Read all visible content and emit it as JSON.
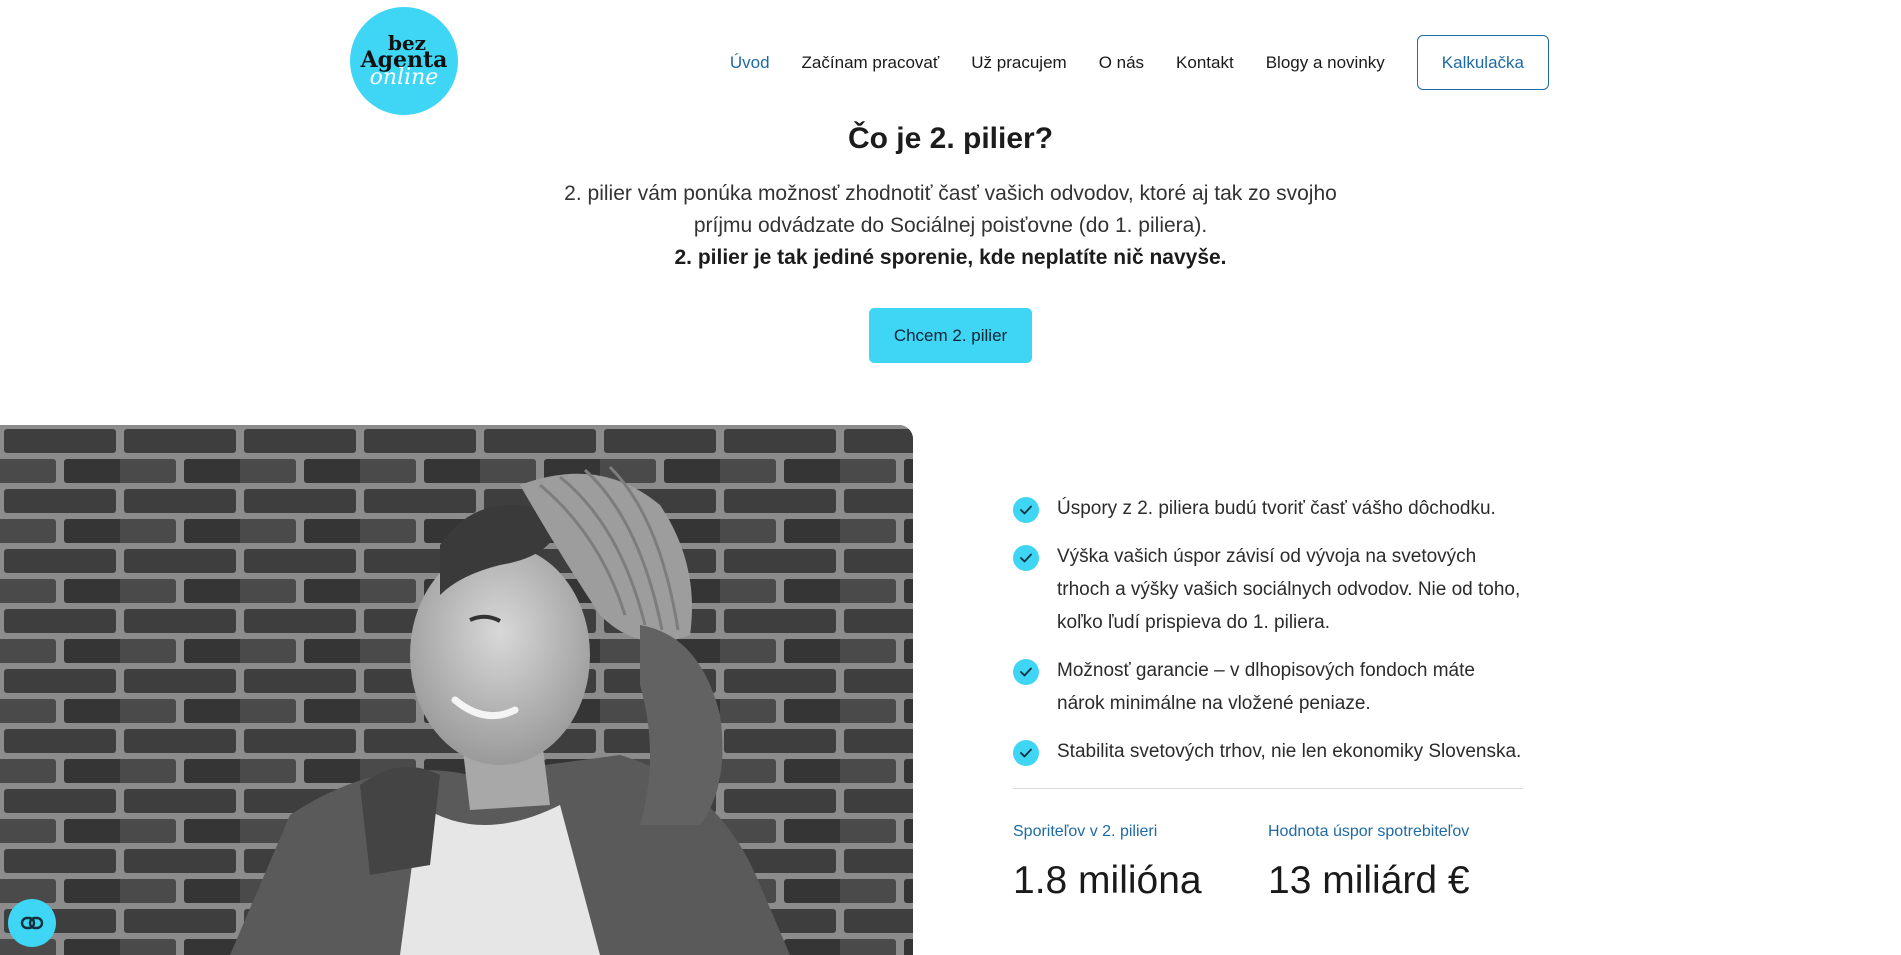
{
  "logo": {
    "line1": "bez",
    "line2": "Agenta",
    "line3": "online"
  },
  "nav": {
    "items": [
      "Úvod",
      "Začínam pracovať",
      "Už pracujem",
      "O nás",
      "Kontakt",
      "Blogy a novinky"
    ],
    "button": "Kalkulačka"
  },
  "intro": {
    "title": "Čo je 2. pilier?",
    "line1": "2. pilier vám ponúka možnosť zhodnotiť časť vašich odvodov, ktoré aj tak zo svojho príjmu odvádzate do Sociálnej poisťovne (do 1. piliera).",
    "line2": "2. pilier je tak jediné sporenie, kde neplatíte nič navyše.",
    "cta": "Chcem 2. pilier"
  },
  "benefits": [
    "Úspory z 2. piliera budú tvoriť časť vášho dôchodku.",
    "Výška vašich úspor závisí od vývoja na svetových trhoch a výšky vašich sociálnych odvodov. Nie od toho, koľko ľudí prispieva do 1. piliera.",
    "Možnosť garancie – v dlhopisových fondoch máte nárok minimálne na vložené peniaze.",
    "Stabilita svetových trhov, nie len ekonomiky Slovenska."
  ],
  "stats": [
    {
      "label": "Sporiteľov v 2. pilieri",
      "value": "1.8 milióna"
    },
    {
      "label": "Hodnota úspor spotrebiteľov",
      "value": "13 miliárd €"
    }
  ],
  "icons": {
    "check": "check-icon",
    "float": "link-icon"
  },
  "colors": {
    "accent": "#3fd6f5",
    "link": "#1f6aa5"
  }
}
